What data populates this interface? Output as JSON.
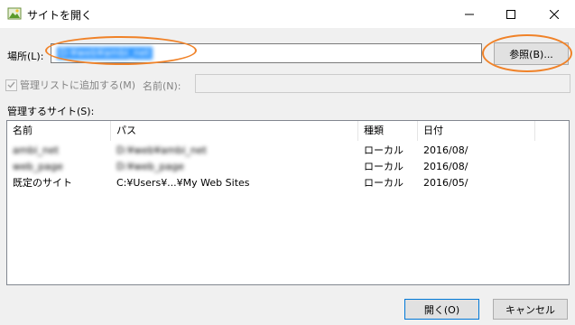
{
  "window": {
    "title": "サイトを開く",
    "minimize_icon": "minimize-icon",
    "maximize_icon": "maximize-icon",
    "close_icon": "close-icon"
  },
  "location": {
    "label": "場所(L):",
    "value": "D:¥web¥ambi_net",
    "browse_label": "参照(B)..."
  },
  "manage": {
    "checkbox_label": "管理リストに追加する(M)",
    "checked": true,
    "name_label": "名前(N):",
    "name_value": ""
  },
  "managed_sites": {
    "label": "管理するサイト(S):",
    "columns": [
      "名前",
      "パス",
      "種類",
      "日付"
    ],
    "rows": [
      {
        "name": "ambi_net",
        "path": "D:¥web¥ambi_net",
        "type": "ローカル",
        "date": "2016/08/"
      },
      {
        "name": "web_page",
        "path": "D:¥web_page",
        "type": "ローカル",
        "date": "2016/08/"
      },
      {
        "name": "既定のサイト",
        "path": "C:¥Users¥...¥My Web Sites",
        "type": "ローカル",
        "date": "2016/05/"
      }
    ]
  },
  "footer": {
    "open_label": "開く(O)",
    "cancel_label": "キャンセル"
  },
  "colors": {
    "selection": "#3399ff",
    "highlight_ring": "#f08228",
    "default_button_border": "#0078d7"
  }
}
